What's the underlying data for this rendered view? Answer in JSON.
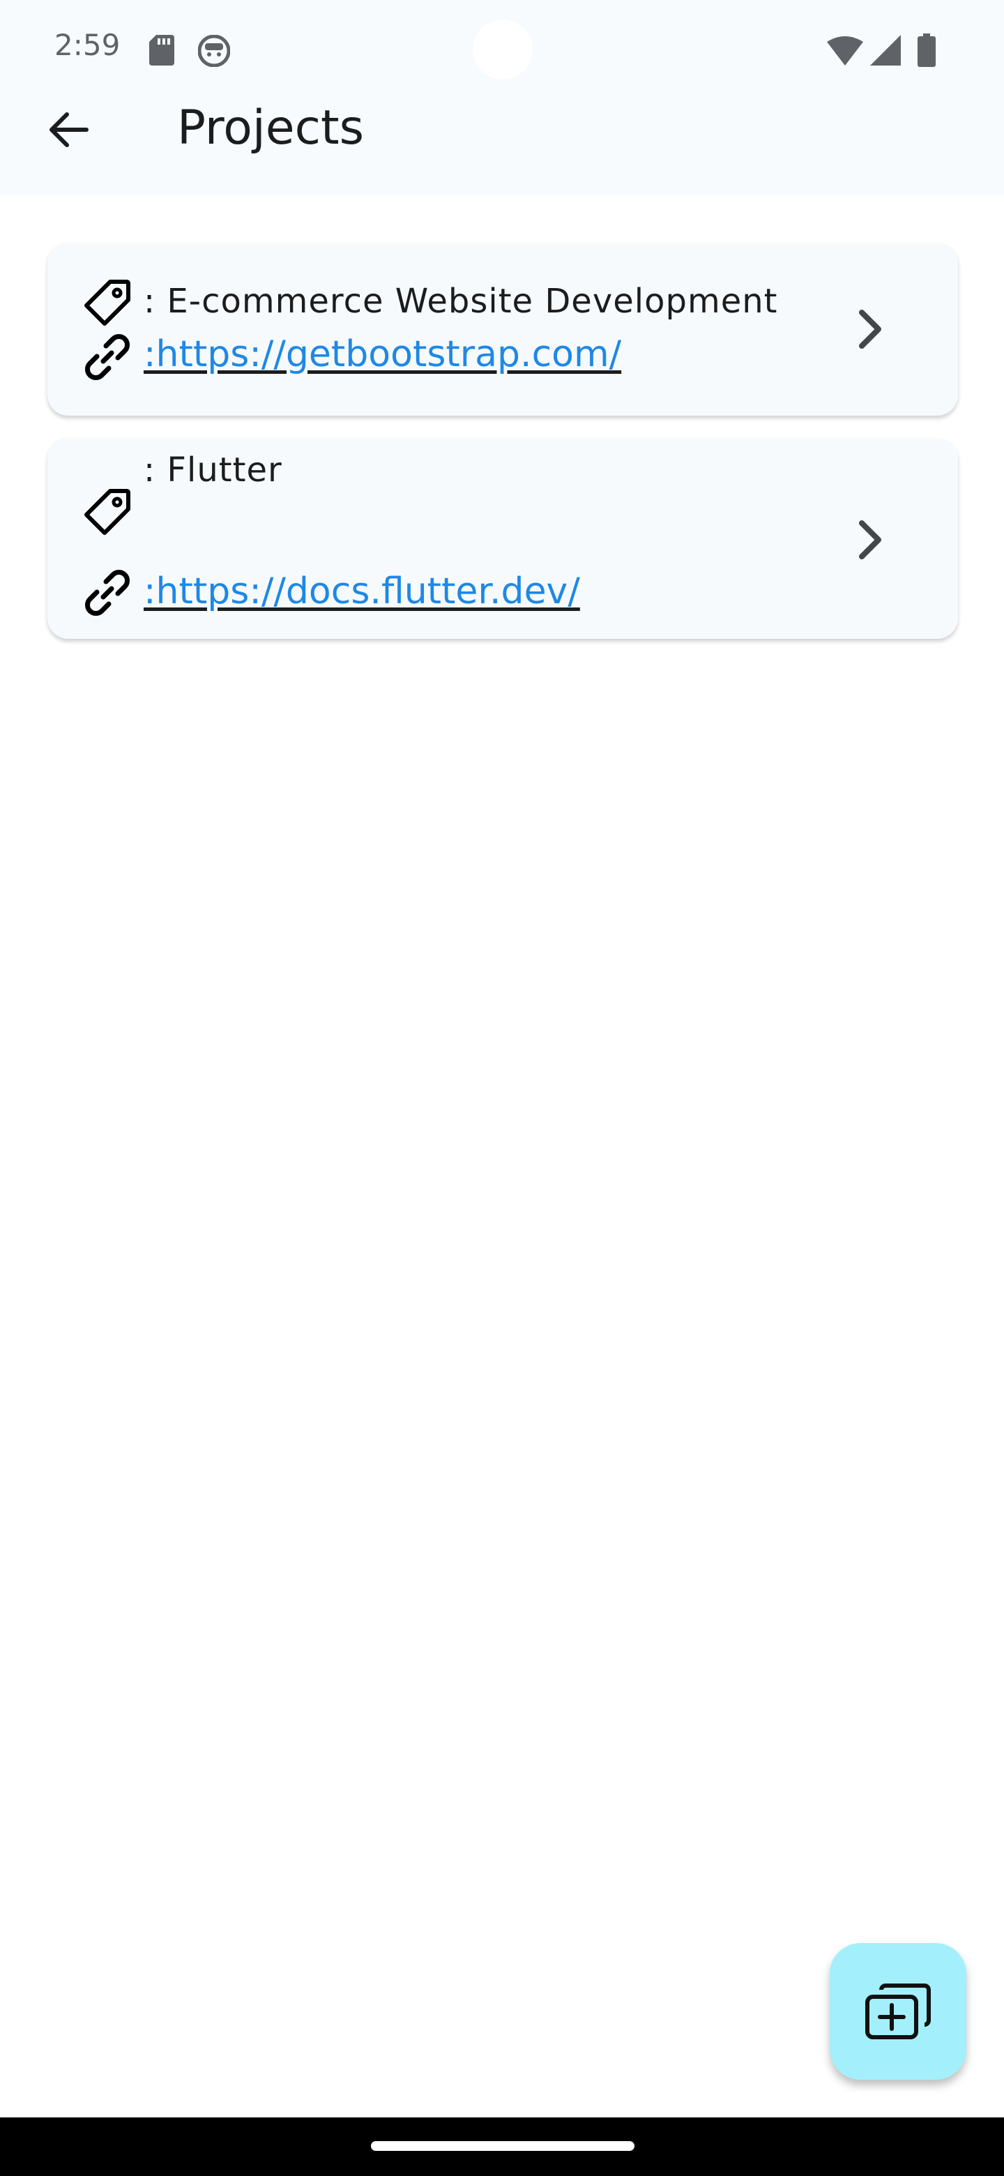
{
  "status_bar": {
    "time": "2:59",
    "icons": [
      "sd-card-icon",
      "android-debug-icon",
      "wifi-icon",
      "cellular-signal-icon",
      "battery-icon"
    ]
  },
  "app_bar": {
    "title": "Projects",
    "back_icon": "arrow-left-icon"
  },
  "projects": [
    {
      "name_label": ": E-commerce Website Development",
      "link_label": ":https://getbootstrap.com/",
      "tag_icon": "tag-icon",
      "link_icon": "link-icon",
      "chevron_icon": "chevron-right-icon"
    },
    {
      "name_label": ": Flutter",
      "link_label": ":https://docs.flutter.dev/",
      "tag_icon": "tag-icon",
      "link_icon": "link-icon",
      "chevron_icon": "chevron-right-icon"
    }
  ],
  "fab": {
    "icon": "add-collection-icon"
  },
  "colors": {
    "link": "#1e88e5",
    "fab_background": "#a3f0fc",
    "card_background": "#f6fafc",
    "app_bar_background": "#f7fbfd"
  }
}
